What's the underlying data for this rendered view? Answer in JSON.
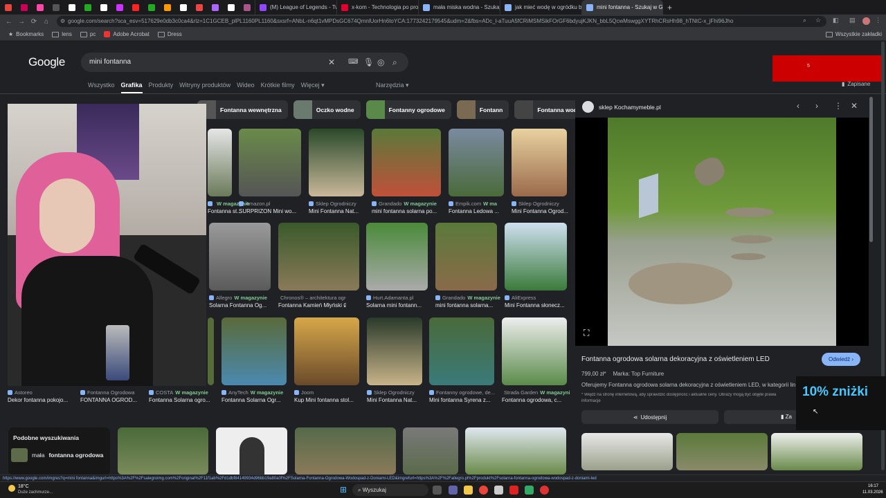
{
  "browser": {
    "tabs": [
      {
        "label": "(M) League of Legends - Twitc",
        "icon": "twitch-icon",
        "color": "#9146ff"
      },
      {
        "label": "x-kom - Technologia po prost",
        "icon": "xkom-icon",
        "color": "#e5002e"
      },
      {
        "label": "mała miska wodna - Szukaj w G",
        "icon": "google-icon",
        "color": "#8ab4f8"
      },
      {
        "label": "jak mieć wodę w ogródku bez",
        "icon": "google-icon",
        "color": "#8ab4f8"
      },
      {
        "label": "mini fontanna - Szukaj w Goo",
        "icon": "google-icon",
        "color": "#8ab4f8",
        "active": true
      }
    ],
    "pinned_tab_colors": [
      "#e8453c",
      "#c05",
      "#f4a",
      "#555",
      "#fff",
      "#2a2",
      "#fff",
      "#c3f",
      "#f22",
      "#2a2",
      "#f90",
      "#fff",
      "#e44",
      "#a6f",
      "#fff",
      "#a58"
    ],
    "new_tab": "+",
    "url": "google.com/search?sca_esv=517629e0db3c0ca4&rlz=1C1GCEB_plPL1160PL1160&sxsrf=ANbL-n6qt1vMPDsGC674QmnlUorHn6toYCA:1773242179545&udm=2&fbs=ADc_l-aTuuA5fCRiMSMSikFOrGF6bdyujKJKN_bbL5QcwMswggXYTRhCRsHh98_hTNtC-x_jFhi96Jho",
    "bookmarks": [
      "Bookmarks",
      "lens",
      "pc",
      "Adobe Acrobat",
      "Dress"
    ],
    "all_bookmarks": "Wszystkie zakładki"
  },
  "google": {
    "logo": "Google",
    "query": "mini fontanna",
    "filters": [
      "Wszystko",
      "Grafika",
      "Produkty",
      "Witryny produktów",
      "Wideo",
      "Krótkie filmy",
      "Więcej ▾"
    ],
    "active_filter": "Grafika",
    "tools": "Narzędzia ▾",
    "saved": "Zapisane",
    "chips": [
      "Fontanna wewnętrzna",
      "Oczko wodne",
      "Fontanny ogrodowe",
      "Fontann",
      "Fontanna wodna"
    ],
    "results": [
      {
        "source": "",
        "badge": "W magazynie",
        "title": "Fontanna st..."
      },
      {
        "source": "Amazon.pl",
        "badge": "",
        "title": "SURPRIZON Mini wo..."
      },
      {
        "source": "Sklep Ogrodniczy",
        "badge": "",
        "title": "Mini Fontanna Nat..."
      },
      {
        "source": "Grandado",
        "badge": "W magazynie",
        "title": "mini fontanna solarna po..."
      },
      {
        "source": "Empik.com",
        "badge": "W ma",
        "title": "Fontanna Ledowa ..."
      },
      {
        "source": "Sklep Ogrodniczy",
        "badge": "",
        "title": "Mini Fontanna Ogrod..."
      },
      {
        "source": "Allegro",
        "badge": "W magazynie",
        "title": "Solarna Fontanna Og..."
      },
      {
        "source": "Chronos® – architektura ogrod...",
        "badge": "",
        "title": "Fontanna Kamień Młyński Ø5..."
      },
      {
        "source": "Hurt.Adamanta.pl",
        "badge": "",
        "title": "Solarna mini fontann..."
      },
      {
        "source": "Grandado",
        "badge": "W magazynie",
        "title": "mini fontanna solarna..."
      },
      {
        "source": "AliExpress",
        "badge": "",
        "title": "Mini Fontanna słonecz..."
      },
      {
        "source": "Astoreo",
        "badge": "",
        "title": "Dekor fontanna pokojo..."
      },
      {
        "source": "Fontanna Ogrodowa",
        "badge": "",
        "title": "FONTANNA OGROD..."
      },
      {
        "source": "COSTA",
        "badge": "W magazynie",
        "title": "Fontanna Solarna ogro..."
      },
      {
        "source": "AnyTech",
        "badge": "W magazynie",
        "title": "Fontanna Solarna Ogr..."
      },
      {
        "source": "Joom",
        "badge": "",
        "title": "Kup Mini fontanna stol..."
      },
      {
        "source": "Sklep Ogrodniczy",
        "badge": "",
        "title": "Mini Fontanna Nat..."
      },
      {
        "source": "Fontanny ogrodowe, de...",
        "badge": "",
        "title": "Mini fontanna Syrena z..."
      },
      {
        "source": "Strada Garden",
        "badge": "W magazynie",
        "title": "Fontanna ogrodowa, c..."
      }
    ],
    "related": {
      "heading": "Podobne wyszukiwania",
      "item_pre": "mała",
      "item_bold": "fontanna ogrodowa"
    }
  },
  "detail": {
    "site": "sklep Kochamymeble.pl",
    "title": "Fontanna ogrodowa solarna dekoracyjna z oświetleniem LED",
    "visit": "Odwiedź ›",
    "price": "799,00 zł*",
    "brand": "Marka: Top Furniture",
    "desc": "Oferujemy Fontanna ogrodowa solarna dekoracyjna z oświetleniem LED, w kategorii linne.",
    "note": "* Wejdź na stronę internetową, aby sprawdzić dostępność i aktualne ceny. Obrazy mogą być objęte prawa",
    "note2": "informacje",
    "share": "Udostępnij",
    "save": "Za"
  },
  "overlay": {
    "promo": "10% zniżki",
    "ad_number": "5"
  },
  "status_url": "https://www.google.com/imgres?q=mini fontanna&imgurl=https%3A%2F%2Fsalegroimg.com%2Foriginal%2F11f1ab%2Fd1dbf84149934d96bb19a80a0f%2FSolarna-Fontanna-Ogrodowa-Wodospad-z-Doniami-LED&imgrefurl=https%3A%2F%2Fallegro.pl%2Fprodukt%2Fsolarna-fontanna-ogrodowa-wodospad-z-doniami-led",
  "taskbar": {
    "weather_temp": "18°C",
    "weather_desc": "Duże zachmurze...",
    "search": "Wyszukaj",
    "time": "16:17",
    "date": "11.03.2026"
  }
}
